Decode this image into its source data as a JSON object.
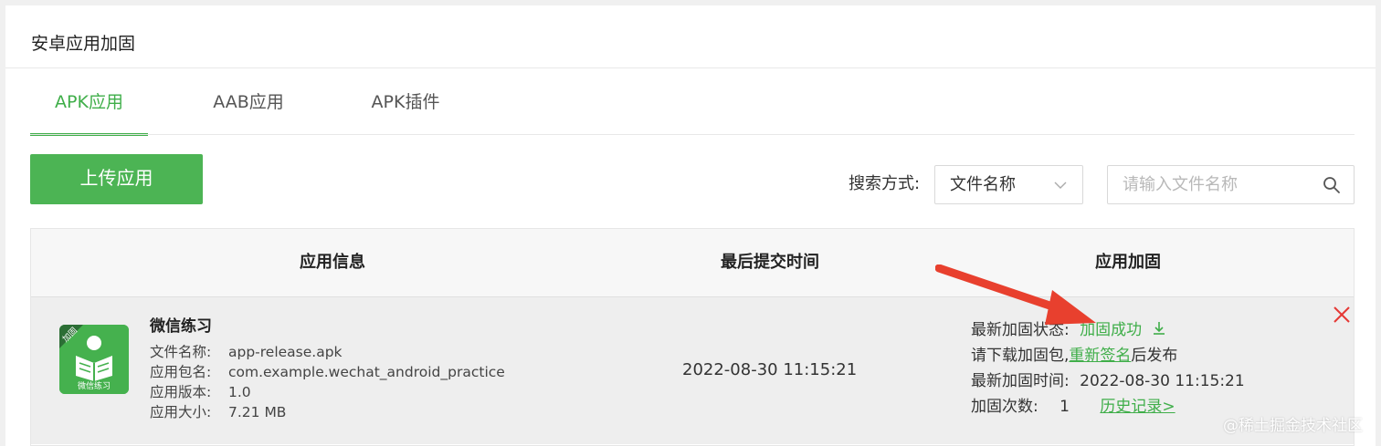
{
  "page": {
    "title": "安卓应用加固"
  },
  "tabs": [
    {
      "label": "APK应用",
      "active": true
    },
    {
      "label": "AAB应用",
      "active": false
    },
    {
      "label": "APK插件",
      "active": false
    }
  ],
  "toolbar": {
    "upload_label": "上传应用",
    "search_mode_label": "搜索方式:",
    "search_mode_value": "文件名称",
    "search_placeholder": "请输入文件名称"
  },
  "table": {
    "headers": [
      "应用信息",
      "最后提交时间",
      "应用加固"
    ],
    "rows": [
      {
        "icon_badge": "加固",
        "icon_caption": "微信练习",
        "app_name": "微信练习",
        "fields": [
          {
            "key": "文件名称:",
            "value": "app-release.apk"
          },
          {
            "key": "应用包名:",
            "value": "com.example.wechat_android_practice"
          },
          {
            "key": "应用版本:",
            "value": "1.0"
          },
          {
            "key": "应用大小:",
            "value": "7.21 MB"
          }
        ],
        "submit_time": "2022-08-30 11:15:21",
        "protection": {
          "status_label": "最新加固状态:",
          "status_value": "加固成功",
          "download_prefix": "请下载加固包,",
          "resign_link": "重新签名",
          "download_suffix": "后发布",
          "time_label": "最新加固时间:",
          "time_value": "2022-08-30 11:15:21",
          "count_label": "加固次数:",
          "count_value": "1",
          "history_link": "历史记录>"
        }
      }
    ]
  },
  "watermark": "@稀土掘金技术社区",
  "colors": {
    "accent": "#3fae49",
    "button": "#4cb454",
    "danger": "#e53935",
    "arrow": "#e8402e"
  },
  "icons": [
    "chevron-down-icon",
    "search-icon",
    "download-icon",
    "close-icon",
    "annotation-arrow"
  ]
}
